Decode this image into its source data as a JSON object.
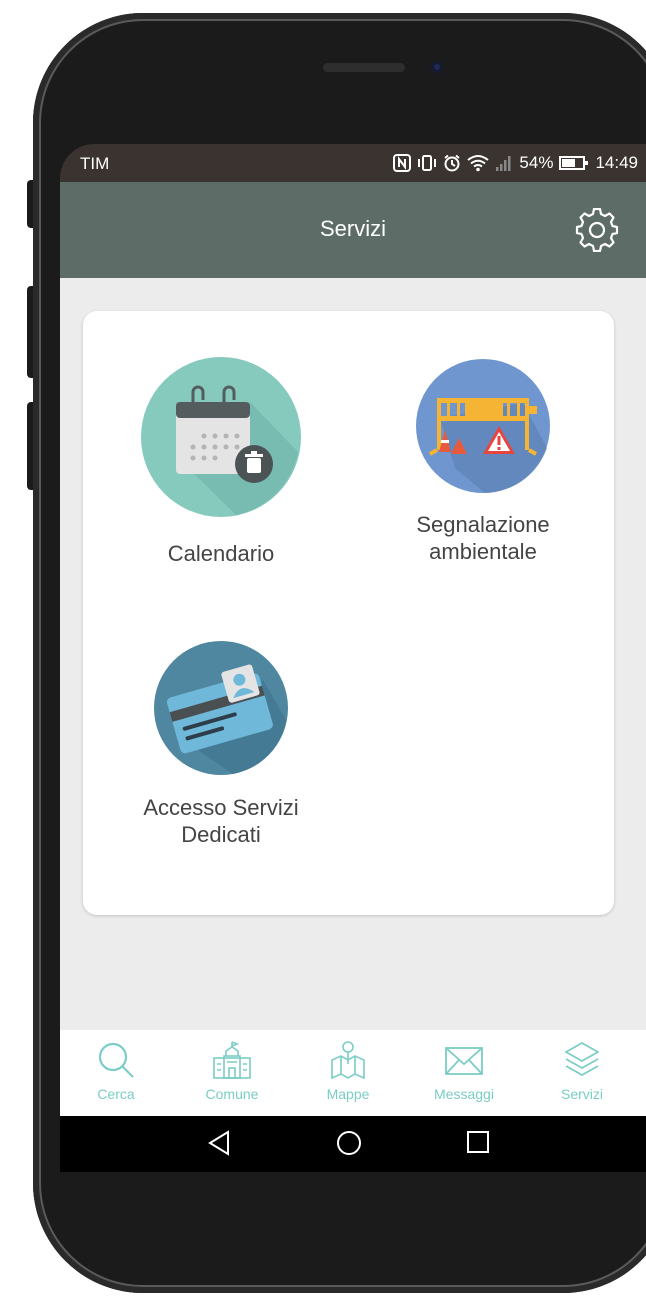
{
  "status_bar": {
    "carrier": "TIM",
    "battery": "54%",
    "time": "14:49"
  },
  "app_bar": {
    "title": "Servizi",
    "settings_icon": "gear-icon"
  },
  "services": [
    {
      "label": "Calendario",
      "icon": "calendar-trash-icon",
      "color": "#86c9bd"
    },
    {
      "label": "Segnalazione ambientale",
      "icon": "construction-barrier-icon",
      "color": "#6f96cf"
    },
    {
      "label": "Accesso Servizi Dedicati",
      "icon": "id-card-icon",
      "color": "#4f87a0"
    }
  ],
  "bottom_nav": [
    {
      "label": "Cerca",
      "icon": "search-icon"
    },
    {
      "label": "Comune",
      "icon": "town-hall-icon"
    },
    {
      "label": "Mappe",
      "icon": "map-pin-icon"
    },
    {
      "label": "Messaggi",
      "icon": "envelope-icon"
    },
    {
      "label": "Servizi",
      "icon": "layers-icon"
    }
  ],
  "colors": {
    "app_bar": "#5e6c68",
    "accent": "#7bcdc5",
    "background": "#ececec"
  }
}
